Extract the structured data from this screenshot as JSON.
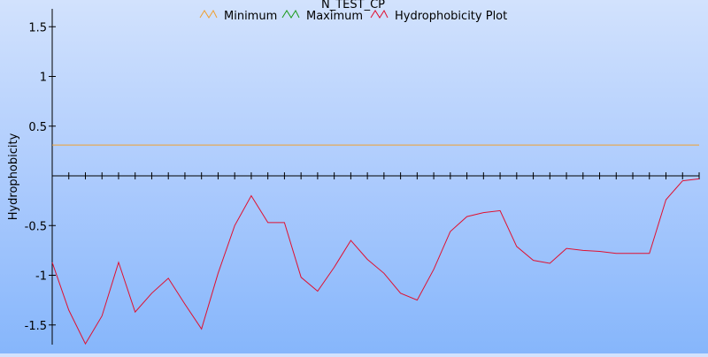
{
  "chart_data": {
    "type": "line",
    "title": "N_TEST_CP",
    "ylabel": "Hydrophobicity",
    "xlabel": "",
    "ylim": [
      -1.7,
      1.7
    ],
    "yticks": [
      {
        "value": 1.5,
        "label": "1.5"
      },
      {
        "value": 1,
        "label": "1"
      },
      {
        "value": 0.5,
        "label": "0.5"
      },
      {
        "value": -0.5,
        "label": "-0.5"
      },
      {
        "value": -1,
        "label": "-1"
      },
      {
        "value": -1.5,
        "label": "-1.5"
      }
    ],
    "xlim": [
      1,
      40
    ],
    "grid": false,
    "legend_position": "top",
    "series": [
      {
        "name": "Minimum",
        "color": "#f0a030",
        "icon": "zigzag-icon",
        "x": [
          1,
          40
        ],
        "values": [
          0.31,
          0.31
        ]
      },
      {
        "name": "Maximum",
        "color": "#1a9a1a",
        "icon": "zigzag-icon",
        "x": [],
        "values": []
      },
      {
        "name": "Hydrophobicity Plot",
        "color": "#e01030",
        "icon": "zigzag-icon",
        "x": [
          1,
          2,
          3,
          4,
          5,
          6,
          7,
          8,
          9,
          10,
          11,
          12,
          13,
          14,
          15,
          16,
          17,
          18,
          19,
          20,
          21,
          22,
          23,
          24,
          25,
          26,
          27,
          28,
          29,
          30,
          31,
          32,
          33,
          34,
          35,
          36,
          37,
          38,
          39,
          40
        ],
        "values": [
          -0.87,
          -1.35,
          -1.69,
          -1.41,
          -0.87,
          -1.37,
          -1.18,
          -1.03,
          -1.29,
          -1.54,
          -0.98,
          -0.5,
          -0.2,
          -0.47,
          -0.47,
          -1.02,
          -1.16,
          -0.92,
          -0.65,
          -0.84,
          -0.98,
          -1.18,
          -1.25,
          -0.94,
          -0.56,
          -0.41,
          -0.37,
          -0.35,
          -0.71,
          -0.85,
          -0.88,
          -0.73,
          -0.75,
          -0.76,
          -0.78,
          -0.78,
          -0.78,
          -0.24,
          -0.05,
          -0.03
        ]
      }
    ]
  }
}
